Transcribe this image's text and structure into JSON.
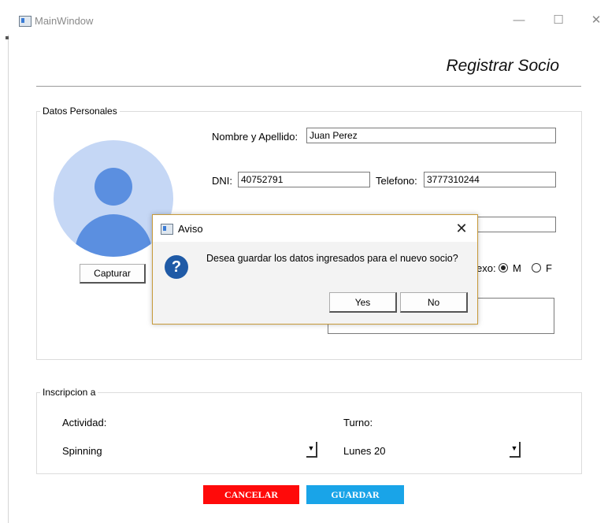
{
  "window": {
    "title": "MainWindow",
    "minimize_glyph": "—",
    "maximize_glyph": "☐",
    "close_glyph": "✕"
  },
  "page": {
    "title": "Registrar Socio"
  },
  "personal": {
    "group_label": "Datos Personales",
    "name_label": "Nombre y Apellido:",
    "name_value": "Juan Perez",
    "dni_label": "DNI:",
    "dni_value": "40752791",
    "phone_label": "Telefono:",
    "phone_value": "3777310244",
    "capture_label": "Capturar",
    "sex_label_fragment": "exo:",
    "sex_options": [
      "M",
      "F"
    ],
    "sex_selected": "M"
  },
  "inscription": {
    "group_label": "Inscripcion a",
    "activity_label": "Actividad:",
    "activity_value": "Spinning",
    "shift_label": "Turno:",
    "shift_value": "Lunes 20"
  },
  "actions": {
    "cancel_label": "CANCELAR",
    "save_label": "GUARDAR"
  },
  "dialog": {
    "title": "Aviso",
    "message": "Desea guardar los datos ingresados para el nuevo socio?",
    "question_glyph": "?",
    "close_glyph": "✕",
    "yes_label": "Yes",
    "no_label": "No"
  },
  "colors": {
    "cancel": "#ff0a0a",
    "save": "#19a4e8",
    "avatar_bg": "#c5d7f5",
    "avatar_fg": "#5b8fe0",
    "dialog_border": "#c79a3a",
    "question_icon": "#1f5aa6"
  },
  "icons": {
    "app": "app-window-icon",
    "question": "question-icon",
    "avatar": "user-avatar-icon",
    "dropdown": "dropdown-arrow-icon"
  }
}
